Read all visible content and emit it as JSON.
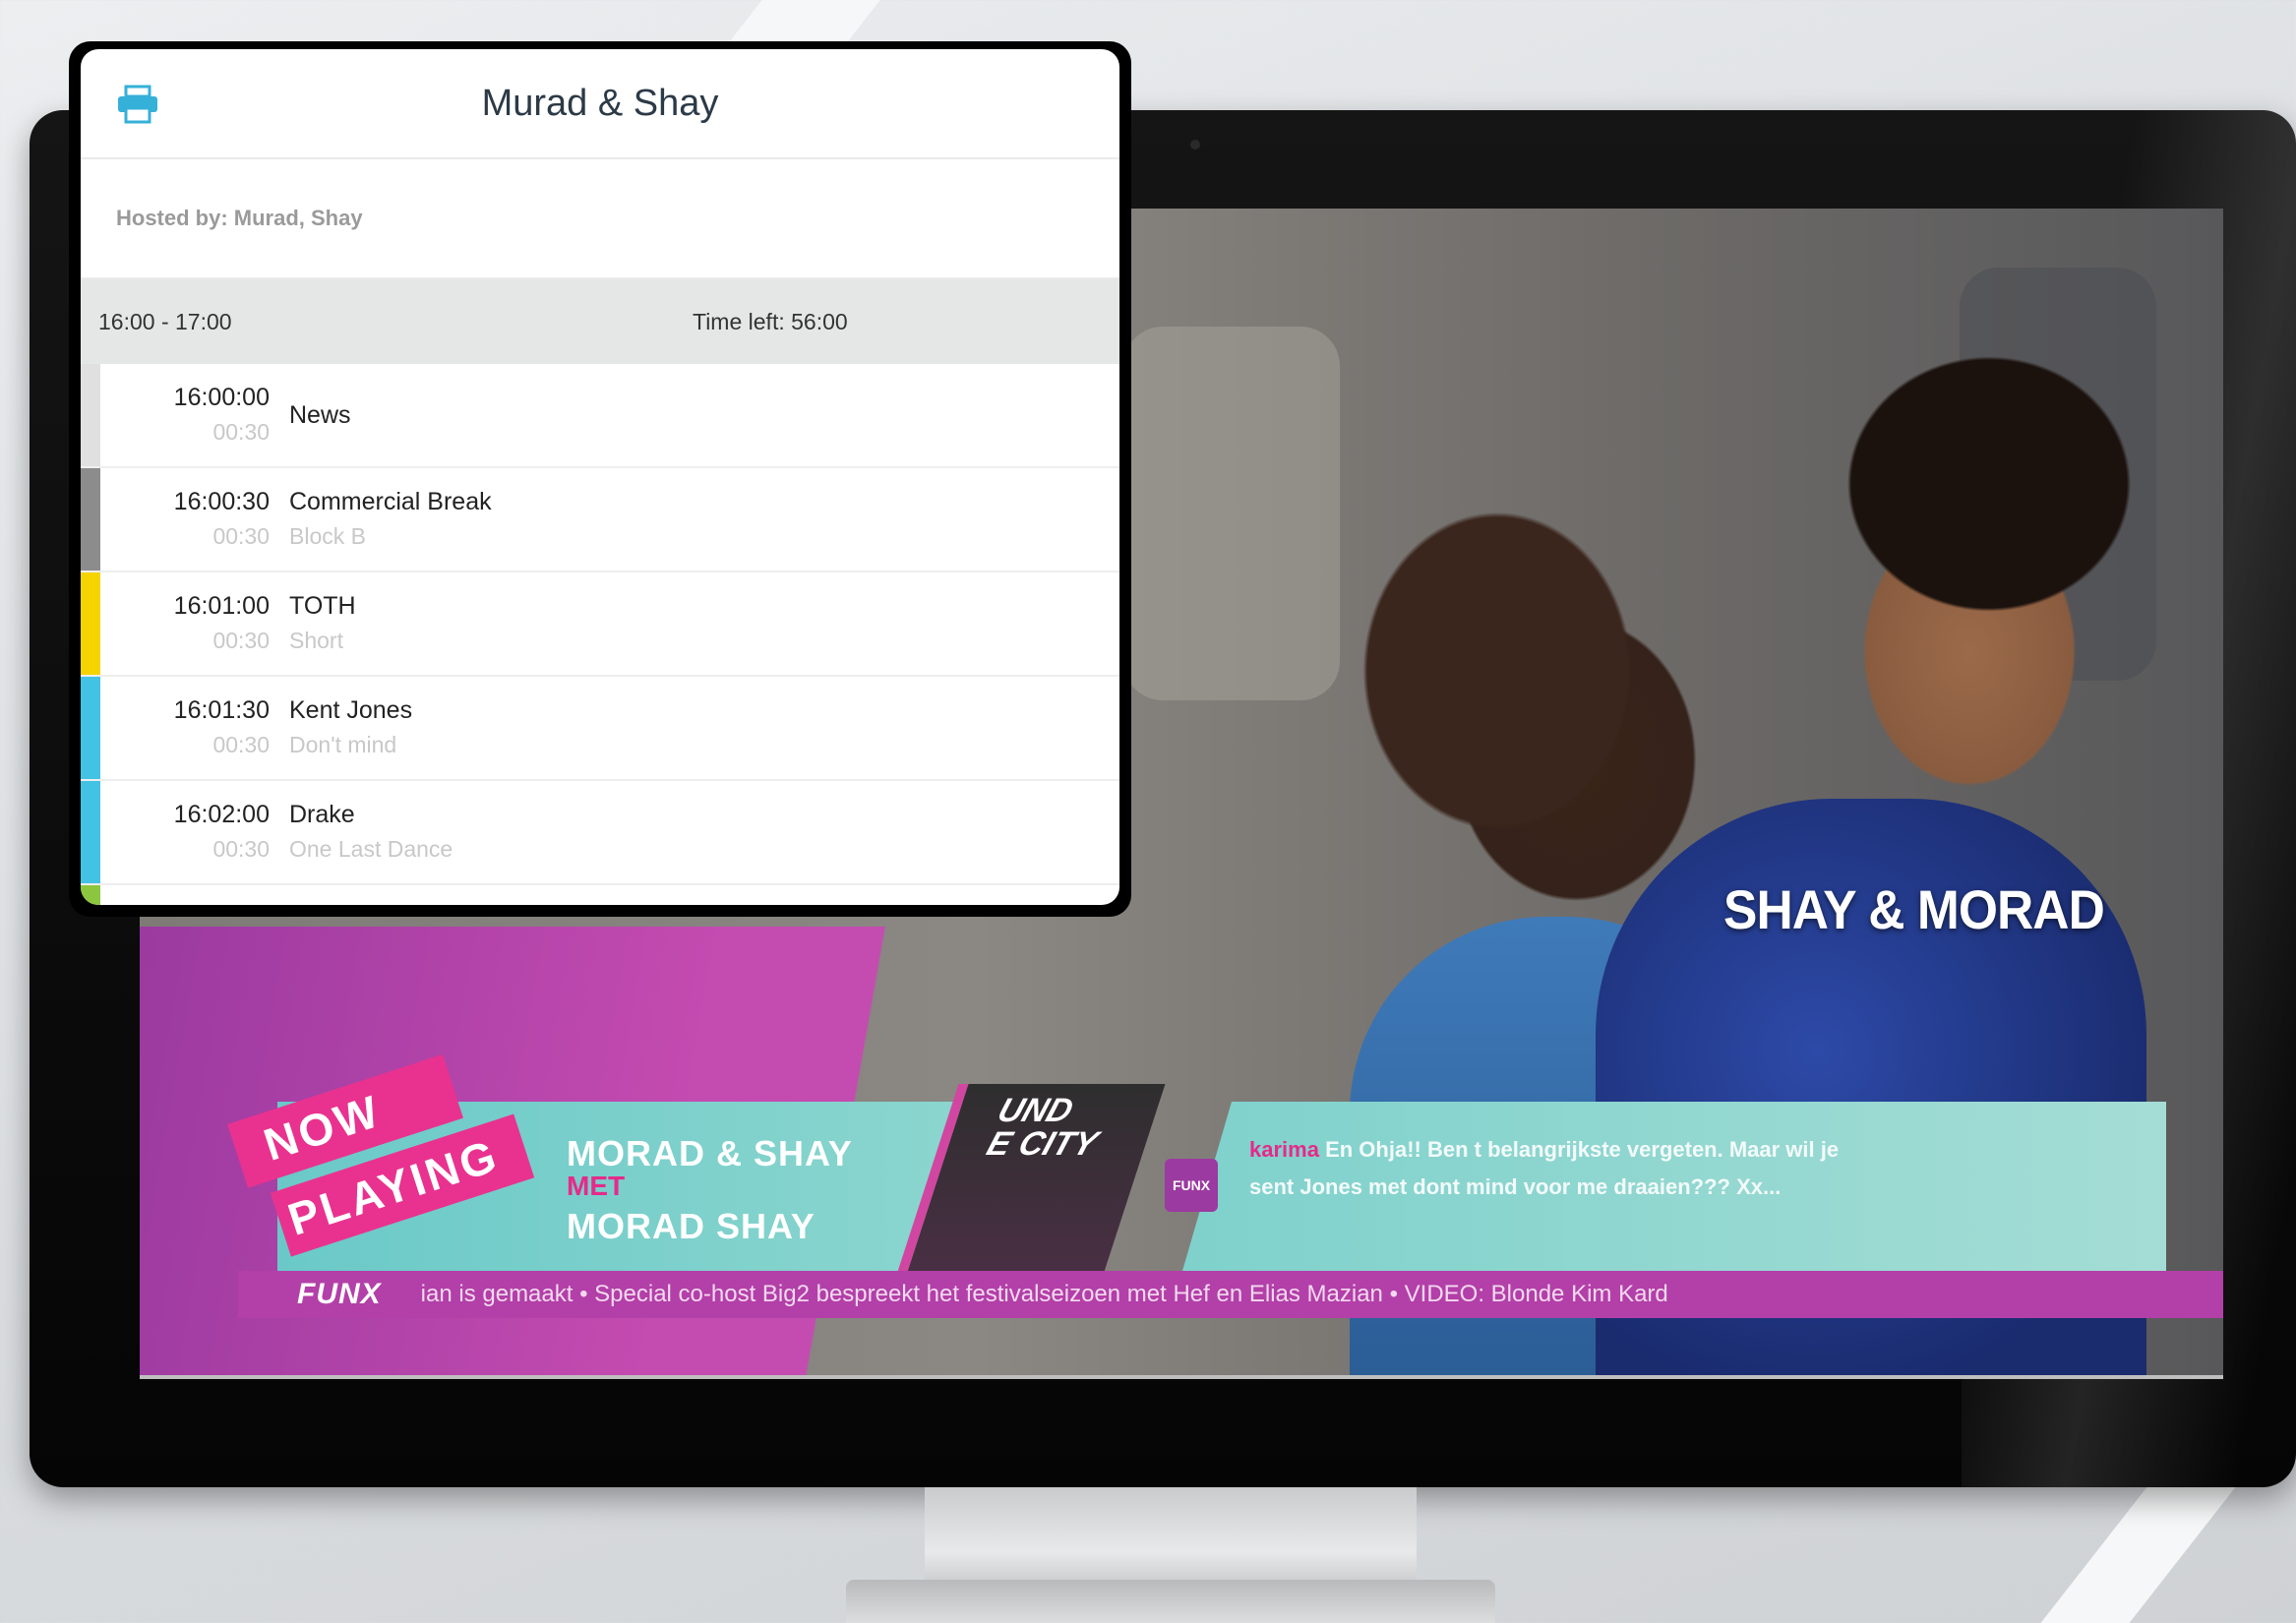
{
  "panel": {
    "title": "Murad & Shay",
    "hosted_by": "Hosted by: Murad, Shay",
    "time_range": "16:00 - 17:00",
    "time_left": "Time left: 56:00",
    "items": [
      {
        "time": "16:00:00",
        "duration": "00:30",
        "title": "News",
        "subtitle": "",
        "color": "#e0e0e0"
      },
      {
        "time": "16:00:30",
        "duration": "00:30",
        "title": "Commercial Break",
        "subtitle": "Block B",
        "color": "#8c8c8c"
      },
      {
        "time": "16:01:00",
        "duration": "00:30",
        "title": "TOTH",
        "subtitle": "Short",
        "color": "#f5d400"
      },
      {
        "time": "16:01:30",
        "duration": "00:30",
        "title": "Kent Jones",
        "subtitle": "Don't mind",
        "color": "#42c3e4"
      },
      {
        "time": "16:02:00",
        "duration": "00:30",
        "title": "Drake",
        "subtitle": "One Last Dance",
        "color": "#42c3e4"
      }
    ]
  },
  "screen": {
    "photo_title": "SHAY & MORAD",
    "now_playing_line1": "NOW",
    "now_playing_line2": "PLAYING",
    "show_line1": "MORAD & SHAY",
    "show_line2": "MET",
    "show_line3": "MORAD SHAY",
    "city_text_line1": "UND",
    "city_text_line2": "E CITY",
    "chat_badge": "FUNX",
    "chat_user": "karima",
    "chat_message": "En Ohja!! Ben t belangrijkste vergeten. Maar wil je sent Jones met dont mind voor me draaien??? Xx...",
    "ticker_logo": "FUNX",
    "ticker_text": "ian is gemaakt • Special co-host Big2 bespreekt het festivalseizoen met Hef en Elias Mazian • VIDEO: Blonde Kim Kard"
  }
}
